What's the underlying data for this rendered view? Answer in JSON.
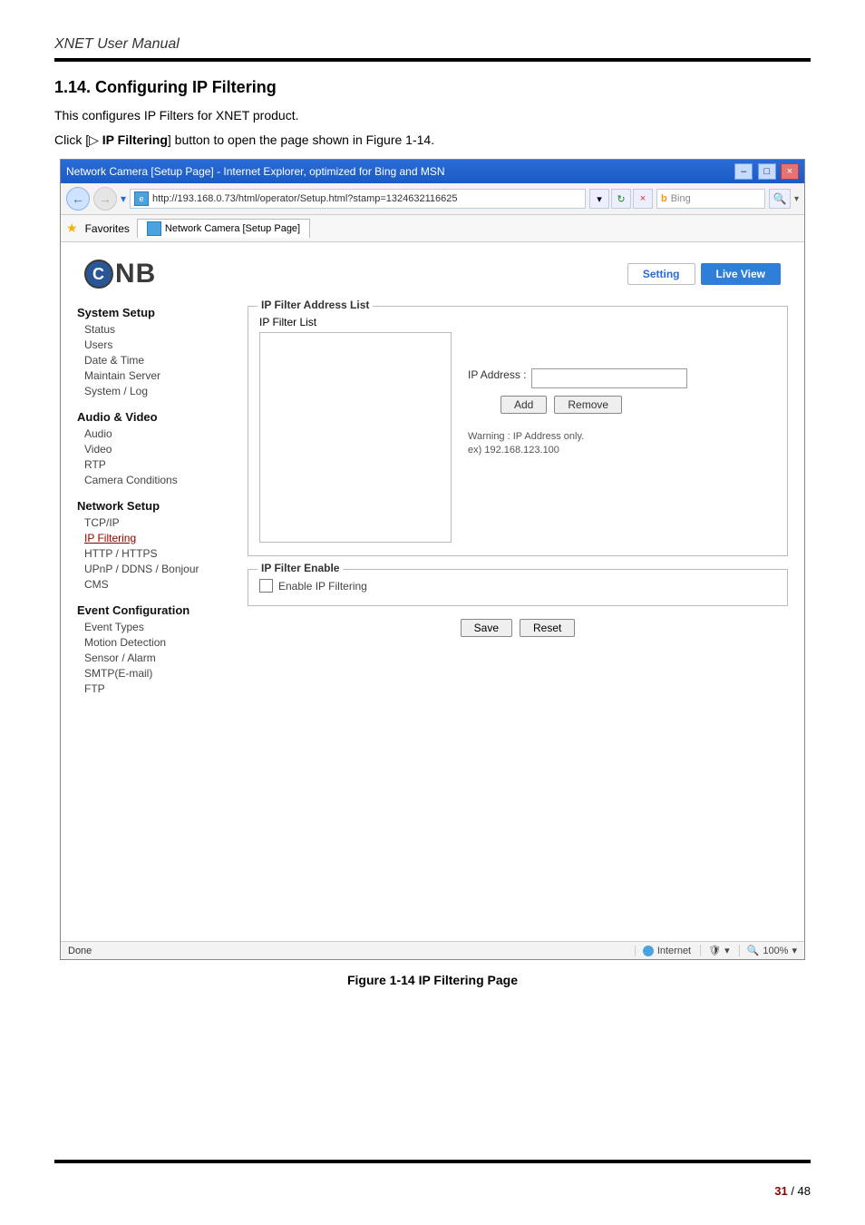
{
  "doc": {
    "manual_title": "XNET User Manual",
    "section": "1.14. Configuring IP Filtering",
    "intro": "This configures IP Filters for XNET product.",
    "click_pre": "Click [",
    "click_sym": "▷",
    "click_bold": " IP Filtering",
    "click_post": "] button to open the page shown in Figure 1-14.",
    "figure_caption": "Figure 1-14 IP Filtering Page",
    "page_num": "31",
    "page_total": " / 48"
  },
  "win": {
    "title": "Network Camera [Setup Page] - Internet Explorer, optimized for Bing and MSN",
    "min": "–",
    "max": "□",
    "close": "×",
    "url": "http://193.168.0.73/html/operator/Setup.html?stamp=1324632116625",
    "bing": "Bing",
    "favorites": "Favorites",
    "tab": "Network Camera [Setup Page]",
    "done": "Done",
    "zone": "Internet",
    "zoom": "100%"
  },
  "app": {
    "logo_text": "NB",
    "setting": "Setting",
    "live": "Live View",
    "groups": {
      "g1": "System Setup",
      "g2": "Audio & Video",
      "g3": "Network Setup",
      "g4": "Event Configuration"
    },
    "items": {
      "status": "Status",
      "users": "Users",
      "datetime": "Date & Time",
      "mserver": "Maintain Server",
      "syslog": "System / Log",
      "audio": "Audio",
      "video": "Video",
      "rtp": "RTP",
      "camcond": "Camera Conditions",
      "tcpip": "TCP/IP",
      "ipfilter": "IP Filtering",
      "http": "HTTP / HTTPS",
      "upnp": "UPnP / DDNS / Bonjour",
      "cms": "CMS",
      "evtypes": "Event Types",
      "motion": "Motion Detection",
      "sensor": "Sensor / Alarm",
      "smtp": "SMTP(E-mail)",
      "ftp": "FTP"
    },
    "panel": {
      "fs1_legend": "IP Filter Address List",
      "list_label": "IP Filter List",
      "ip_label": "IP Address :",
      "add": "Add",
      "remove": "Remove",
      "warn1": "Warning : IP Address only.",
      "warn2": "ex) 192.168.123.100",
      "fs2_legend": "IP Filter Enable",
      "enable_chk": "Enable IP Filtering",
      "save": "Save",
      "reset": "Reset"
    }
  }
}
